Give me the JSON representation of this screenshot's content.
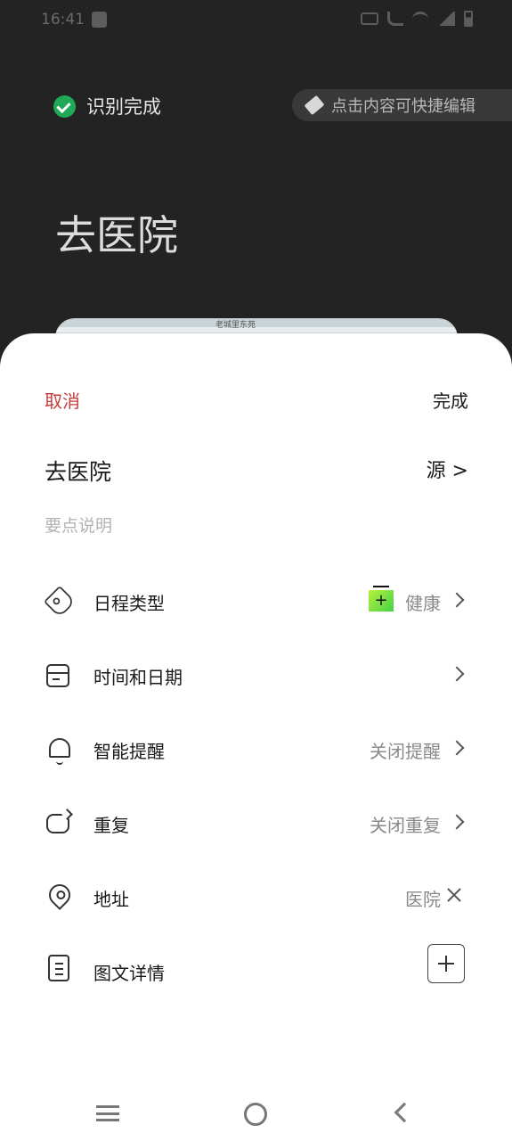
{
  "status_bar": {
    "time": "16:41"
  },
  "recognition": {
    "status_text": "识别完成"
  },
  "edit_hint": {
    "text": "点击内容可快捷编辑"
  },
  "background": {
    "title": "去医院",
    "map_label": "老城里东苑"
  },
  "sheet": {
    "cancel_label": "取消",
    "done_label": "完成",
    "title": "去医院",
    "source_label": "源 >",
    "notes_placeholder": "要点说明"
  },
  "rows": [
    {
      "key": "type",
      "label": "日程类型",
      "value": "健康",
      "badge": "+",
      "icon": "tag-icon"
    },
    {
      "key": "datetime",
      "label": "时间和日期",
      "value": "",
      "icon": "calendar-icon"
    },
    {
      "key": "reminder",
      "label": "智能提醒",
      "value": "关闭提醒",
      "icon": "bell-icon"
    },
    {
      "key": "repeat",
      "label": "重复",
      "value": "关闭重复",
      "icon": "repeat-icon"
    },
    {
      "key": "address",
      "label": "地址",
      "value": "医院",
      "icon": "location-pin-icon"
    },
    {
      "key": "details",
      "label": "图文详情",
      "value": "",
      "icon": "document-icon"
    }
  ],
  "colors": {
    "accent_red": "#c63d3d",
    "check_green": "#1fa956",
    "health_badge": "#7ee13f"
  }
}
